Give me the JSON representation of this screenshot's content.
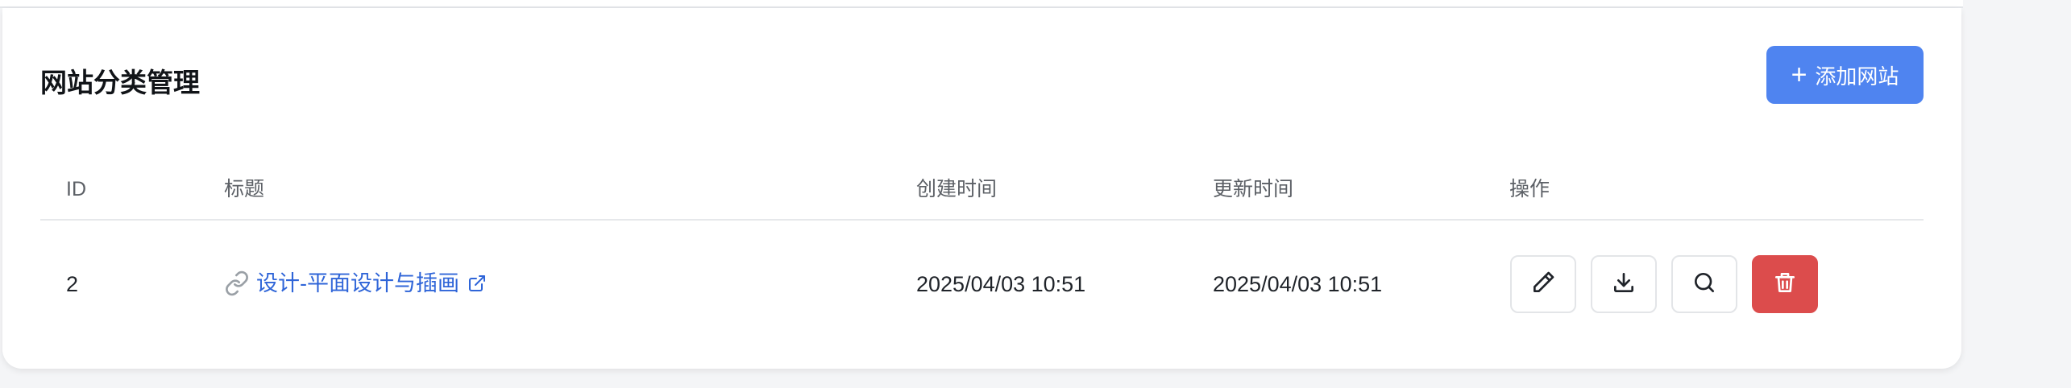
{
  "panel": {
    "title": "网站分类管理",
    "add_button": {
      "label": "添加网站",
      "icon": "plus-icon"
    }
  },
  "table": {
    "columns": [
      "ID",
      "标题",
      "创建时间",
      "更新时间",
      "操作"
    ],
    "rows": [
      {
        "id": "2",
        "title": "设计-平面设计与插画",
        "created": "2025/04/03 10:51",
        "updated": "2025/04/03 10:51",
        "actions": [
          "edit-icon",
          "download-icon",
          "search-icon",
          "delete-icon"
        ]
      }
    ]
  },
  "colors": {
    "primary": "#4f84f0",
    "link": "#2f65d8",
    "danger": "#dc4c4c"
  }
}
